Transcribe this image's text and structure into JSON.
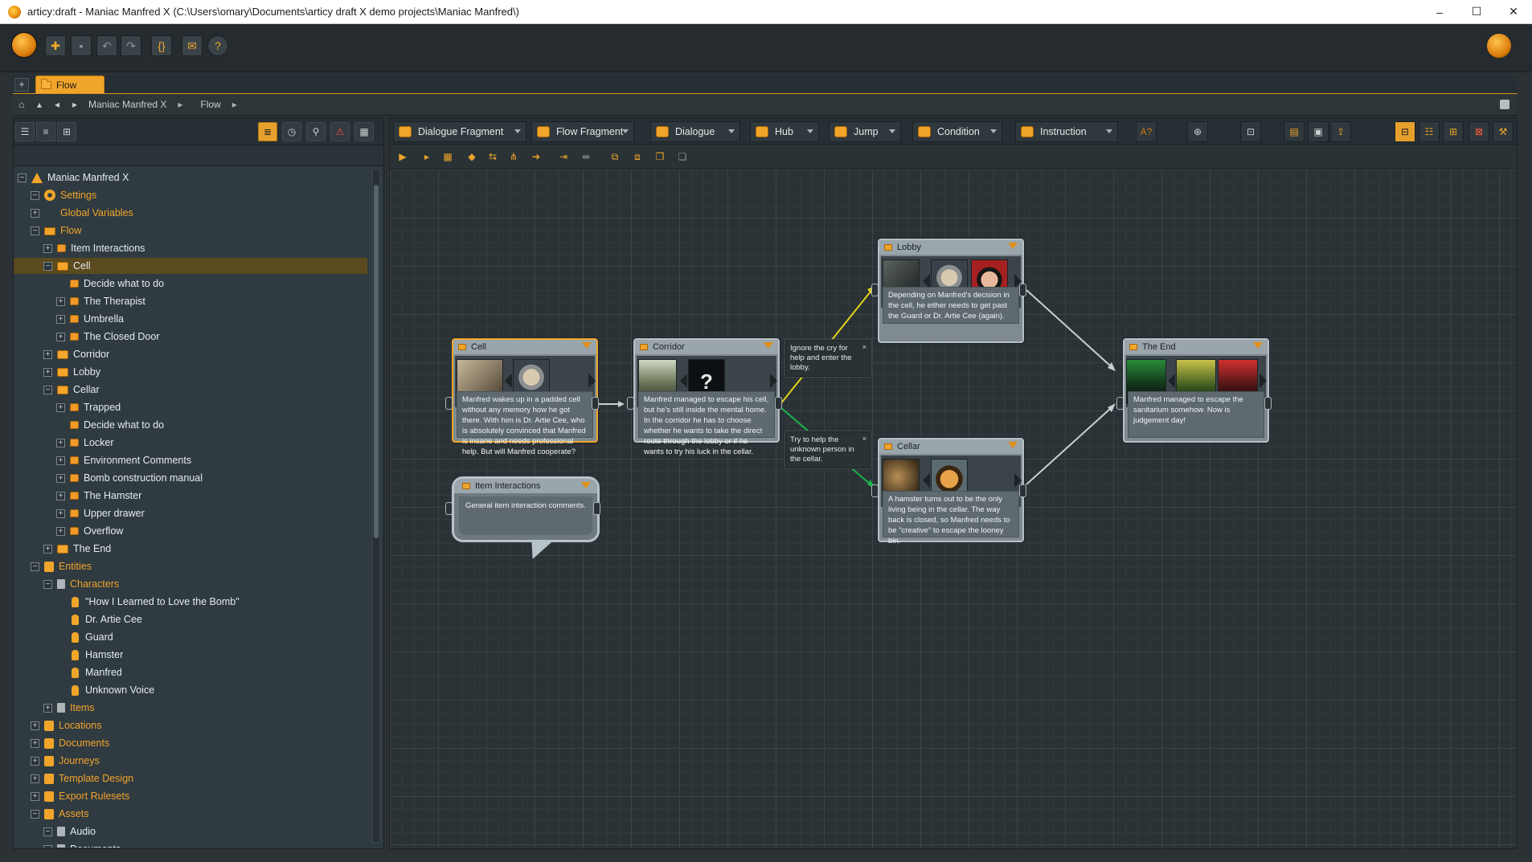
{
  "window": {
    "title": "articy:draft - Maniac Manfred X (C:\\Users\\omary\\Documents\\articy draft X demo projects\\Maniac Manfred\\)",
    "controls": [
      "–",
      "☐",
      "✕"
    ]
  },
  "toolbar": {
    "icons": [
      "new-icon",
      "save-icon",
      "undo-icon",
      "redo-icon",
      "build-icon",
      "mail-icon",
      "help-icon"
    ]
  },
  "tabs": {
    "add": "+",
    "flow": "Flow"
  },
  "breadcrumb": {
    "project": "Maniac Manfred X",
    "section": "Flow",
    "arrow": "▸"
  },
  "tree": [
    {
      "label": "Maniac Manfred X",
      "level": 0,
      "exp": "−",
      "icon": "root",
      "cls": ""
    },
    {
      "label": "Settings",
      "level": 1,
      "exp": "−",
      "icon": "gear",
      "cls": "orange"
    },
    {
      "label": "Global Variables",
      "level": 1,
      "exp": "+",
      "icon": "var",
      "cls": "orange"
    },
    {
      "label": "Flow",
      "level": 1,
      "exp": "−",
      "icon": "folder",
      "cls": "orange"
    },
    {
      "label": "Item Interactions",
      "level": 2,
      "exp": "+",
      "icon": "dialogue",
      "cls": ""
    },
    {
      "label": "Cell",
      "level": 2,
      "exp": "−",
      "icon": "flowfrag",
      "cls": "selected"
    },
    {
      "label": "Decide what to do",
      "level": 3,
      "exp": "",
      "icon": "dialogue",
      "cls": ""
    },
    {
      "label": "The Therapist",
      "level": 3,
      "exp": "+",
      "icon": "dialogue",
      "cls": ""
    },
    {
      "label": "Umbrella",
      "level": 3,
      "exp": "+",
      "icon": "dialogue",
      "cls": ""
    },
    {
      "label": "The Closed Door",
      "level": 3,
      "exp": "+",
      "icon": "dialogue",
      "cls": ""
    },
    {
      "label": "Corridor",
      "level": 2,
      "exp": "+",
      "icon": "flowfrag",
      "cls": ""
    },
    {
      "label": "Lobby",
      "level": 2,
      "exp": "+",
      "icon": "flowfrag",
      "cls": ""
    },
    {
      "label": "Cellar",
      "level": 2,
      "exp": "−",
      "icon": "flowfrag",
      "cls": ""
    },
    {
      "label": "Trapped",
      "level": 3,
      "exp": "+",
      "icon": "dialogue",
      "cls": ""
    },
    {
      "label": "Decide what to do",
      "level": 3,
      "exp": "",
      "icon": "dialogue",
      "cls": ""
    },
    {
      "label": "Locker",
      "level": 3,
      "exp": "+",
      "icon": "dialogue",
      "cls": ""
    },
    {
      "label": "Environment Comments",
      "level": 3,
      "exp": "+",
      "icon": "dialogue",
      "cls": ""
    },
    {
      "label": "Bomb construction manual",
      "level": 3,
      "exp": "+",
      "icon": "dialogue",
      "cls": ""
    },
    {
      "label": "The Hamster",
      "level": 3,
      "exp": "+",
      "icon": "dialogue",
      "cls": ""
    },
    {
      "label": "Upper drawer",
      "level": 3,
      "exp": "+",
      "icon": "dialogue",
      "cls": ""
    },
    {
      "label": "Overflow",
      "level": 3,
      "exp": "+",
      "icon": "dialogue",
      "cls": ""
    },
    {
      "label": "The End",
      "level": 2,
      "exp": "+",
      "icon": "flowfrag",
      "cls": ""
    },
    {
      "label": "Entities",
      "level": 1,
      "exp": "−",
      "icon": "entities",
      "cls": "orange"
    },
    {
      "label": "Characters",
      "level": 2,
      "exp": "−",
      "icon": "page",
      "cls": "orange"
    },
    {
      "label": "\"How I Learned to Love the Bomb\"",
      "level": 3,
      "exp": "",
      "icon": "char",
      "cls": ""
    },
    {
      "label": "Dr. Artie Cee",
      "level": 3,
      "exp": "",
      "icon": "char",
      "cls": ""
    },
    {
      "label": "Guard",
      "level": 3,
      "exp": "",
      "icon": "char",
      "cls": ""
    },
    {
      "label": "Hamster",
      "level": 3,
      "exp": "",
      "icon": "char",
      "cls": ""
    },
    {
      "label": "Manfred",
      "level": 3,
      "exp": "",
      "icon": "char",
      "cls": ""
    },
    {
      "label": "Unknown Voice",
      "level": 3,
      "exp": "",
      "icon": "char",
      "cls": ""
    },
    {
      "label": "Items",
      "level": 2,
      "exp": "+",
      "icon": "page",
      "cls": "orange"
    },
    {
      "label": "Locations",
      "level": 1,
      "exp": "+",
      "icon": "entities",
      "cls": "orange"
    },
    {
      "label": "Documents",
      "level": 1,
      "exp": "+",
      "icon": "entities",
      "cls": "orange"
    },
    {
      "label": "Journeys",
      "level": 1,
      "exp": "+",
      "icon": "entities",
      "cls": "orange"
    },
    {
      "label": "Template Design",
      "level": 1,
      "exp": "+",
      "icon": "entities",
      "cls": "orange"
    },
    {
      "label": "Export Rulesets",
      "level": 1,
      "exp": "+",
      "icon": "entities",
      "cls": "orange"
    },
    {
      "label": "Assets",
      "level": 1,
      "exp": "−",
      "icon": "entities",
      "cls": "orange"
    },
    {
      "label": "Audio",
      "level": 2,
      "exp": "−",
      "icon": "page",
      "cls": ""
    },
    {
      "label": "Documents",
      "level": 2,
      "exp": "−",
      "icon": "page",
      "cls": ""
    }
  ],
  "editor": {
    "templates": [
      "Dialogue Fragment",
      "Flow Fragment",
      "Dialogue",
      "Hub",
      "Jump",
      "Condition",
      "Instruction"
    ]
  },
  "nodes": {
    "cell": {
      "title": "Cell",
      "text": "Manfred wakes up in a padded cell without any memory how he got there. With him is Dr. Artie Cee, who is absolutely convinced that Manfred is insane and needs professional help. But will Manfred cooperate?"
    },
    "corridor": {
      "title": "Corridor",
      "text": "Manfred managed to escape his cell, but he's still inside the mental home. In the corridor he has to choose whether he wants to take the direct route through the lobby or if he wants to try his luck in the cellar."
    },
    "lobby": {
      "title": "Lobby",
      "text": "Depending on Manfred's decision in the cell, he either needs to get past the Guard or Dr. Artie Cee (again)."
    },
    "cellar": {
      "title": "Cellar",
      "text": "A hamster turns out to be the only living being in the cellar. The way back is closed, so Manfred needs to be \"creative\" to escape the looney bin."
    },
    "theend": {
      "title": "The End",
      "text": "Manfred managed to escape the sanitarium somehow. Now is judgement day!"
    },
    "items": {
      "title": "Item Interactions",
      "text": "General item interaction comments."
    },
    "unknown_mark": "?"
  },
  "pinlabels": {
    "lobby": "Ignore the cry for help and enter the lobby.",
    "cellar": "Try to help the unknown person in the cellar.",
    "close": "×"
  },
  "colors": {
    "accent": "#f0a52a",
    "canvas": "#2b3236",
    "link_yellow": "#e0d21a",
    "link_green": "#1bb34a"
  }
}
